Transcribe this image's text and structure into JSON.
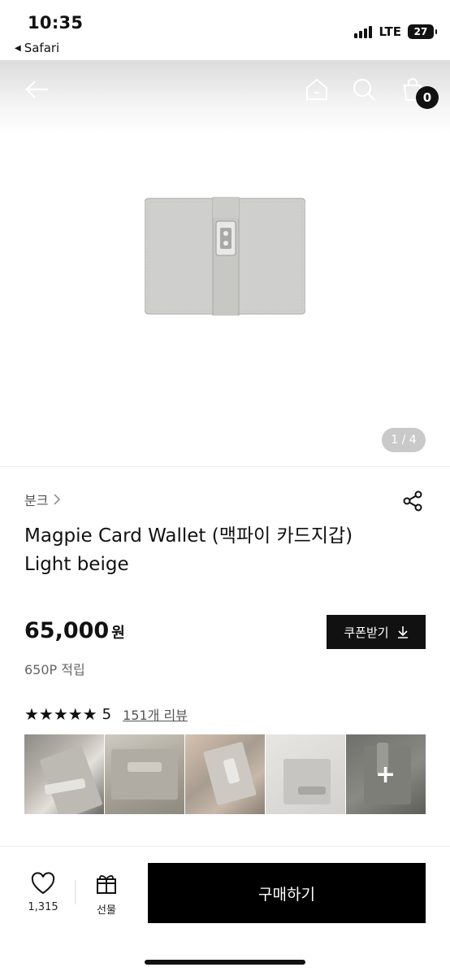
{
  "status_bar": {
    "time": "10:35",
    "back_app": "Safari",
    "network": "LTE",
    "battery": "27"
  },
  "header": {
    "cart_count": "0",
    "icons": [
      "back-arrow-icon",
      "home-icon",
      "search-icon",
      "shopping-bag-icon"
    ]
  },
  "gallery": {
    "pager": "1 / 4"
  },
  "product": {
    "brand": "분크",
    "title_line1": "Magpie Card Wallet (맥파이 카드지갑)",
    "title_line2": "Light beige",
    "price": "65,000",
    "currency": "원",
    "points": "650P 적립",
    "coupon_label": "쿠폰받기"
  },
  "rating": {
    "stars": "★★★★★",
    "score": "5",
    "reviews": "151개 리뷰"
  },
  "bottom": {
    "wish_count": "1,315",
    "gift_label": "선물",
    "buy_label": "구매하기"
  },
  "colors": {
    "primary": "#000000",
    "text": "#111111",
    "muted": "#666666",
    "pager_bg": "#c9c9c9"
  }
}
